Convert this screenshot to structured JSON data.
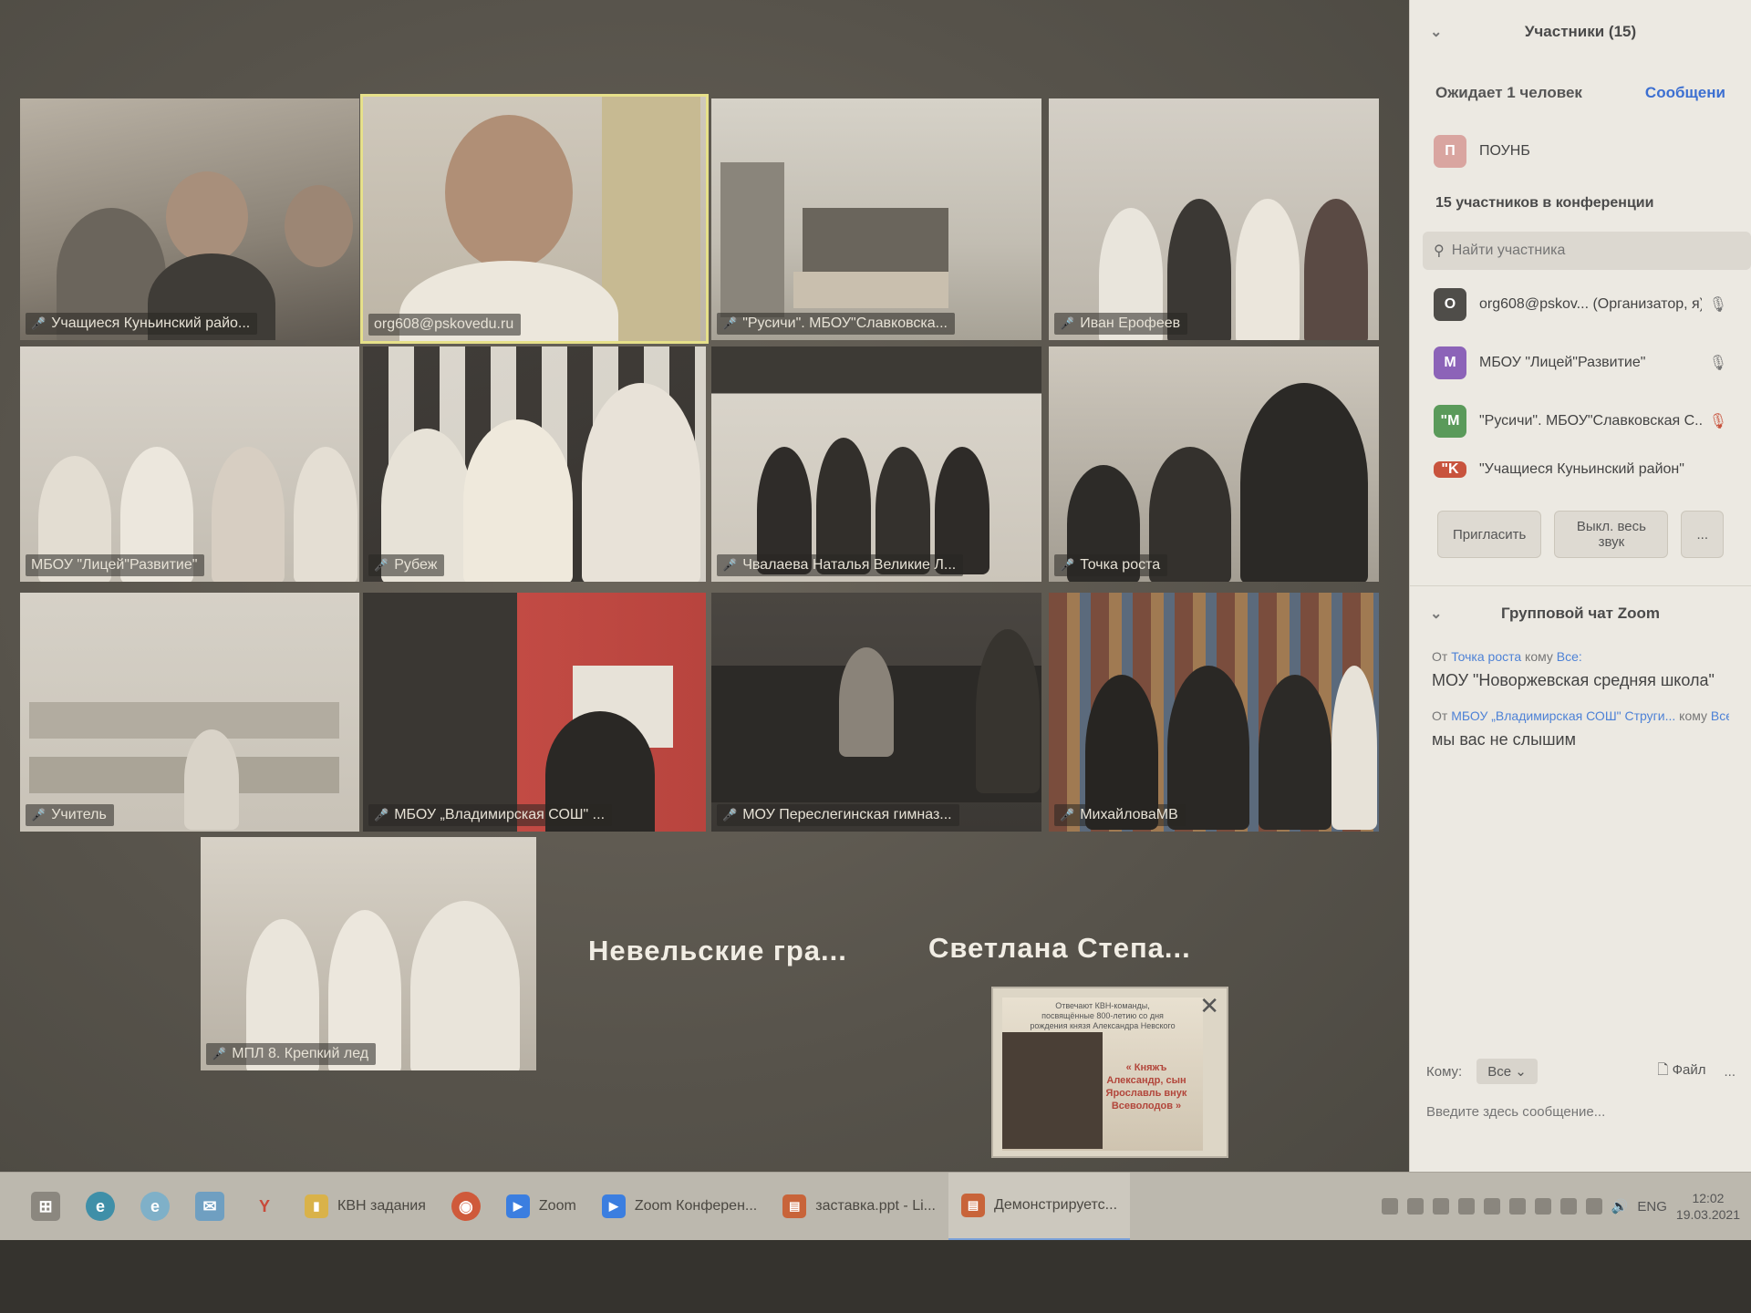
{
  "gallery": {
    "tiles": [
      {
        "label": "Учащиеся Куньинский райо..."
      },
      {
        "label": "org608@pskovedu.ru",
        "active": true
      },
      {
        "label": "\"Русичи\". МБОУ\"Славковска..."
      },
      {
        "label": "Иван Ерофеев"
      },
      {
        "label": "МБОУ \"Лицей\"Развитие\""
      },
      {
        "label": "Рубеж"
      },
      {
        "label": "Чвалаева Наталья Великие Л..."
      },
      {
        "label": "Точка роста"
      },
      {
        "label": "Учитель"
      },
      {
        "label": "МБОУ „Владимирская СОШ\" ..."
      },
      {
        "label": "МОУ Переслегинская гимназ..."
      },
      {
        "label": "МихайловаМВ"
      },
      {
        "label": "МПЛ 8. Крепкий лед"
      }
    ],
    "name_only": [
      {
        "label": "Невельские гра..."
      },
      {
        "label": "Светлана Степа..."
      }
    ]
  },
  "share_thumbnail": {
    "slide_top_text": "Отвечают КВН-команды, посвящённые 800-летию со дня рождения князя Александра Невского",
    "slide_red_text": "« Княжъ Александр, сын Ярославль внук Всеволодов »",
    "close_icon": "close-icon"
  },
  "participants_panel": {
    "title": "Участники (15)",
    "waiting_text": "Ожидает 1 человек",
    "waiting_action": "Сообщени",
    "waiting_user": {
      "initial": "П",
      "name": "ПОУНБ",
      "color": "#d9a5a0"
    },
    "in_conference_label": "15 участников в конференции",
    "search_placeholder": "Найти участника",
    "participants": [
      {
        "initial": "O",
        "name": "org608@pskov...",
        "role": "(Организатор, я)",
        "color": "#4f4d49"
      },
      {
        "initial": "M",
        "name": "МБОУ \"Лицей\"Развитие\"",
        "role": "",
        "color": "#8c63b8"
      },
      {
        "initial": "\"M",
        "name": "\"Русичи\". МБОУ\"Славковская С...",
        "role": "",
        "color": "#5a9a5a"
      },
      {
        "initial": "\"K",
        "name": "\"Учащиеся Куньинский район\"",
        "role": "",
        "color": "#c8533d"
      }
    ],
    "invite_button": "Пригласить",
    "mute_all_button": "Выкл. весь звук",
    "more_button": "..."
  },
  "chat": {
    "title": "Групповой чат Zoom",
    "messages": [
      {
        "from_prefix": "От",
        "from": "Точка роста",
        "to_prefix": "кому",
        "to": "Все:",
        "text": "МОУ \"Новоржевская средняя школа\""
      },
      {
        "from_prefix": "От",
        "from": "МБОУ „Владимирская СОШ\" Струги...",
        "to_prefix": "кому",
        "to": "Все",
        "text": "мы вас не слышим"
      }
    ],
    "to_label": "Кому:",
    "to_value": "Все",
    "file_label": "Файл",
    "more_label": "...",
    "input_placeholder": "Введите здесь сообщение..."
  },
  "taskbar": {
    "apps": [
      {
        "label": "КВН задания",
        "icon": "folder-icon",
        "color": "#d9b24a"
      },
      {
        "label": "Zoom",
        "icon": "zoom-icon",
        "color": "#3b7ee0"
      },
      {
        "label": "Zoom Конферен...",
        "icon": "zoom-icon",
        "color": "#3b7ee0"
      },
      {
        "label": "заставка.ppt - Li...",
        "icon": "impress-icon",
        "color": "#c8643a"
      },
      {
        "label": "Демонстрируетс...",
        "icon": "impress-icon",
        "color": "#c8643a",
        "active": true
      }
    ],
    "lang": "ENG",
    "time": "12:02",
    "date": "19.03.2021"
  },
  "colors": {
    "active_border": "#e6e08a",
    "link": "#3c6fd1",
    "mic_muted": "#d6623a"
  }
}
